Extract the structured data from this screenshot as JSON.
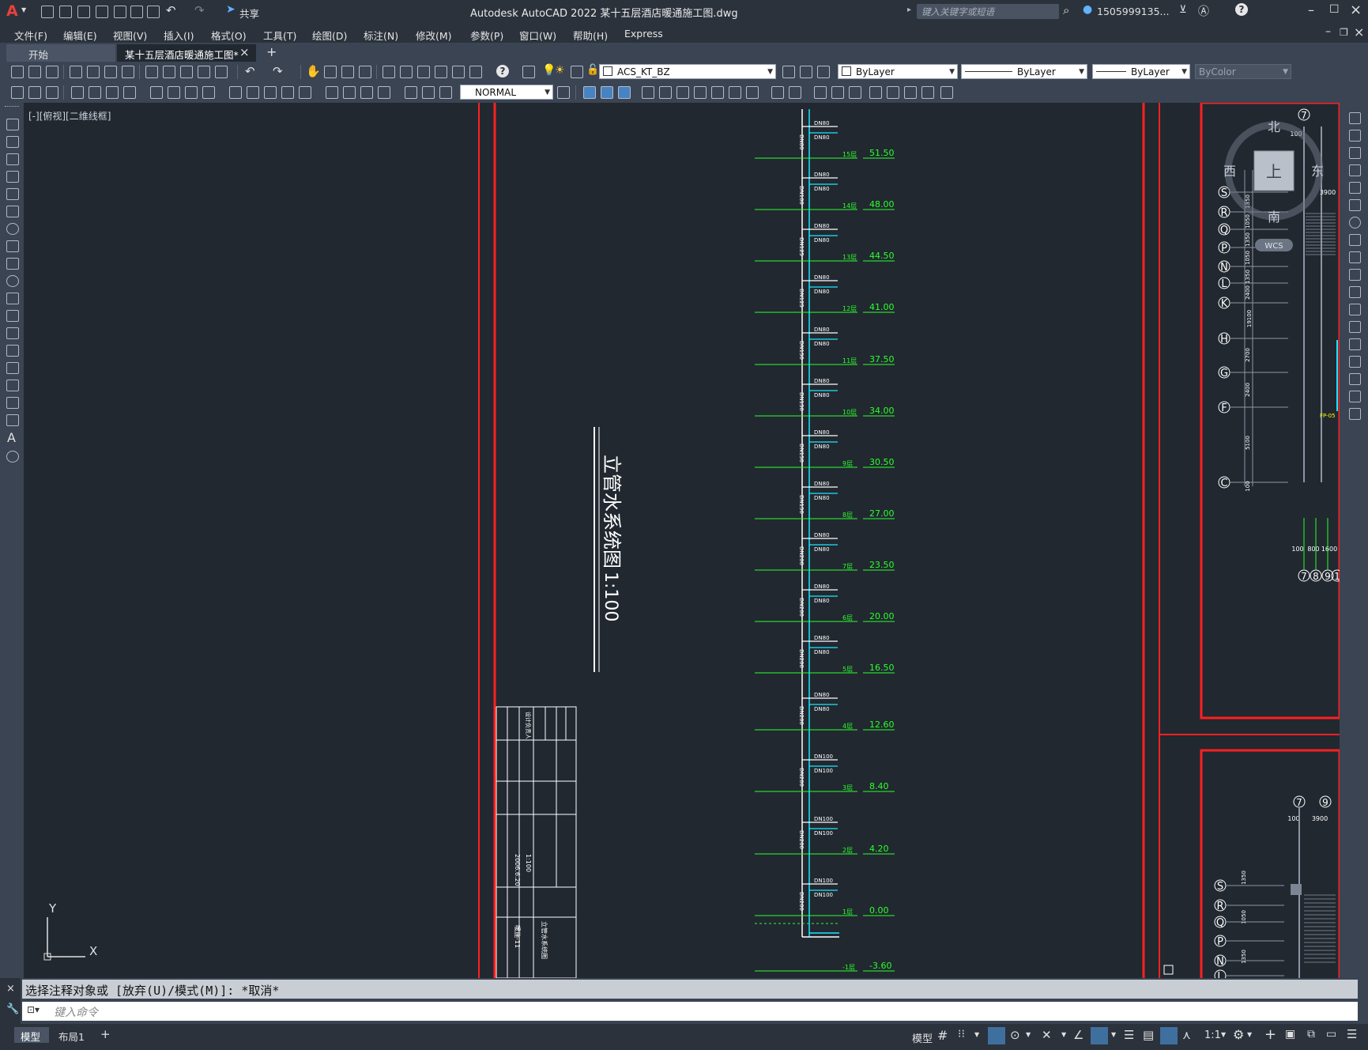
{
  "titlebar": {
    "app_letter": "A",
    "share_label": "共享",
    "title": "Autodesk AutoCAD 2022    某十五层酒店暖通施工图.dwg",
    "search_placeholder": "键入关键字或短语",
    "user": "1505999135...",
    "help": "?"
  },
  "menubar": {
    "items": [
      "文件(F)",
      "编辑(E)",
      "视图(V)",
      "插入(I)",
      "格式(O)",
      "工具(T)",
      "绘图(D)",
      "标注(N)",
      "修改(M)",
      "参数(P)",
      "窗口(W)",
      "帮助(H)",
      "Express"
    ]
  },
  "tabs": {
    "start": "开始",
    "document": "某十五层酒店暖通施工图*",
    "close": "×",
    "add": "+"
  },
  "toolbar": {
    "layer": "ACS_KT_BZ",
    "color": "ByLayer",
    "linetype": "ByLayer",
    "lineweight": "ByLayer",
    "plotstyle": "ByColor",
    "dimstyle": "NORMAL"
  },
  "viewport": {
    "label": "[-][俯视][二维线框]",
    "ucs_x": "X",
    "ucs_y": "Y"
  },
  "drawing": {
    "title": "立管水系统图",
    "scale": "1:100",
    "floors": [
      {
        "floor": "15层",
        "elev": "51.50",
        "branch": "DN80"
      },
      {
        "floor": "14层",
        "elev": "48.00",
        "branch": "DN80"
      },
      {
        "floor": "13层",
        "elev": "44.50",
        "branch": "DN80"
      },
      {
        "floor": "12层",
        "elev": "41.00",
        "branch": "DN80"
      },
      {
        "floor": "11层",
        "elev": "37.50",
        "branch": "DN80"
      },
      {
        "floor": "10层",
        "elev": "34.00",
        "branch": "DN80"
      },
      {
        "floor": "9层",
        "elev": "30.50",
        "branch": "DN80"
      },
      {
        "floor": "8层",
        "elev": "27.00",
        "branch": "DN80"
      },
      {
        "floor": "7层",
        "elev": "23.50",
        "branch": "DN80"
      },
      {
        "floor": "6层",
        "elev": "20.00",
        "branch": "DN80"
      },
      {
        "floor": "5层",
        "elev": "16.50",
        "branch": "DN80"
      },
      {
        "floor": "4层",
        "elev": "12.60",
        "branch": "DN80"
      },
      {
        "floor": "3层",
        "elev": "8.40",
        "branch": "DN100"
      },
      {
        "floor": "2层",
        "elev": "4.20",
        "branch": "DN100"
      },
      {
        "floor": "1层",
        "elev": "0.00",
        "branch": "DN100"
      },
      {
        "floor": "-1层",
        "elev": "-3.60",
        "branch": ""
      }
    ],
    "riser_sizes": [
      "DN80",
      "DN100",
      "DN125",
      "DN125",
      "DN150",
      "DN150",
      "DN150",
      "DN150",
      "DN200",
      "DN200",
      "DN200",
      "DN200",
      "DN200",
      "DN200",
      "DN200"
    ],
    "titleblock": {
      "scale": "1:100",
      "date": "2006.6.20",
      "drawing_no": "暖施-11",
      "name": "立管水系统图",
      "role": "设计负责人"
    },
    "compass": {
      "n": "北",
      "s": "南",
      "e": "东",
      "w": "西",
      "top": "上",
      "wcs": "WCS"
    },
    "axis_labels_right": [
      "S",
      "R",
      "Q",
      "P",
      "N",
      "L",
      "K",
      "H",
      "G",
      "F",
      "C"
    ],
    "axis_labels_lower": [
      "S",
      "R",
      "Q",
      "P",
      "N",
      "L"
    ],
    "grid_numbers_right": [
      "7",
      "8",
      "9",
      "1"
    ],
    "grid_top_lower": [
      "7",
      "9"
    ],
    "dims_right": [
      "100",
      "3900",
      "1350",
      "1050",
      "1350",
      "1050",
      "1350",
      "2400",
      "19100",
      "2700",
      "2400",
      "5100",
      "100"
    ],
    "dims_bottom": [
      "100",
      "800",
      "1600"
    ],
    "dims_lower": [
      "100",
      "3900",
      "1350",
      "1050",
      "1350"
    ],
    "fp_label": "FP-05"
  },
  "command": {
    "history": "选择注释对象或 [放弃(U)/模式(M)]: *取消*",
    "placeholder": "键入命令"
  },
  "statusbar": {
    "tab_model": "模型",
    "tab_layout": "布局1",
    "add": "+",
    "model_label": "模型",
    "scale": "1:1"
  }
}
